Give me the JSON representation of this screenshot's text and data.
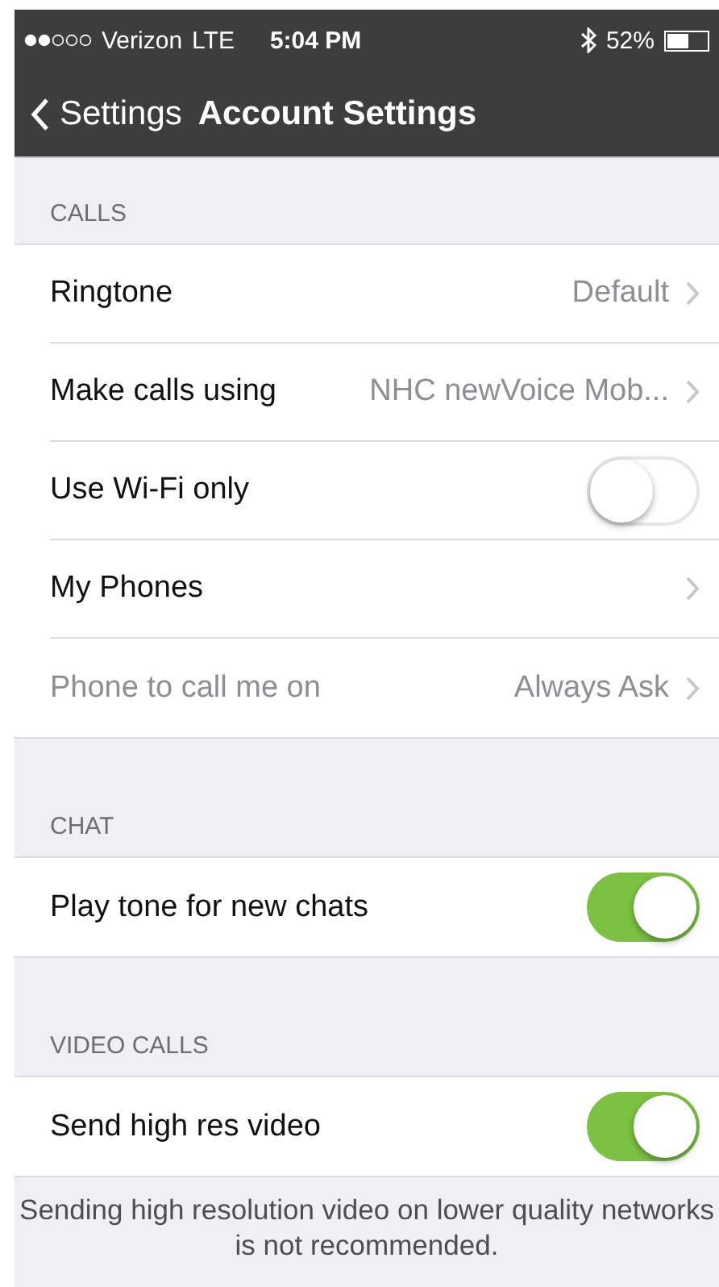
{
  "status_bar": {
    "carrier": "Verizon",
    "network": "LTE",
    "time": "5:04 PM",
    "battery": "52%"
  },
  "nav": {
    "back": "Settings",
    "title": "Account Settings"
  },
  "sections": [
    {
      "header": "CALLS",
      "rows": [
        {
          "kind": "value",
          "label": "Ringtone",
          "value": "Default",
          "disabled": false
        },
        {
          "kind": "value",
          "label": "Make calls using",
          "value": "NHC newVoice Mob...",
          "disabled": false
        },
        {
          "kind": "toggle",
          "label": "Use Wi-Fi only",
          "on": false,
          "disabled": false
        },
        {
          "kind": "value",
          "label": "My Phones",
          "disabled": false
        },
        {
          "kind": "value",
          "label": "Phone to call me on",
          "value": "Always Ask",
          "disabled": true
        }
      ]
    },
    {
      "header": "CHAT",
      "rows": [
        {
          "kind": "toggle",
          "label": "Play tone for new chats",
          "on": true,
          "disabled": false
        }
      ]
    },
    {
      "header": "VIDEO CALLS",
      "rows": [
        {
          "kind": "toggle",
          "label": "Send high res video",
          "on": true,
          "disabled": false
        }
      ],
      "footer": "Sending high resolution video on lower quality networks is not recommended."
    }
  ]
}
